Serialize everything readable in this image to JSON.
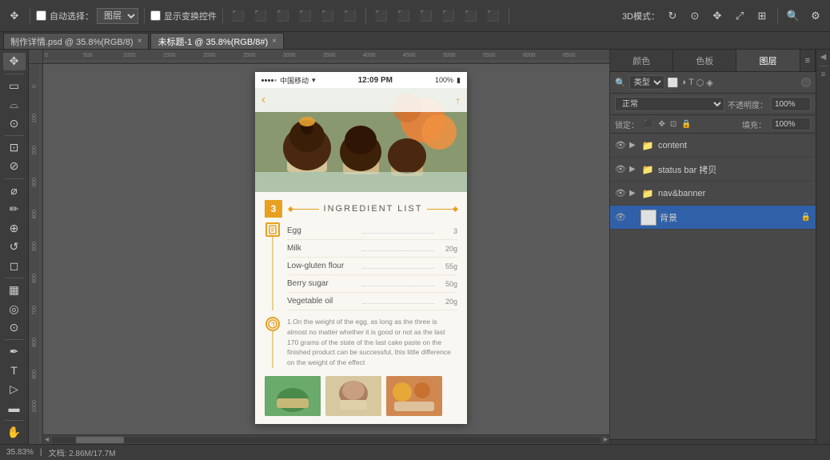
{
  "app": {
    "title": "Adobe Photoshop"
  },
  "toolbar": {
    "auto_select_label": "自动选择：",
    "layer_label": "图层",
    "transform_label": "显示变换控件",
    "mode_label": "3D模式："
  },
  "tabs": [
    {
      "id": "tab1",
      "label": "制作详情.psd @ 35.8%(RGB/8)",
      "active": false,
      "modified": true
    },
    {
      "id": "tab2",
      "label": "未标题-1 @ 35.8%(RGB/8#)",
      "active": true,
      "modified": true
    }
  ],
  "phone": {
    "status_bar": {
      "signal": "●●●●○",
      "carrier": "中国移动",
      "wifi": "▼",
      "time": "12:09 PM",
      "battery": "100%"
    },
    "nav": {
      "back": "‹",
      "title": "",
      "share": "↑"
    },
    "step_number": "3",
    "section_title": "INGREDIENT LIST",
    "ingredients": [
      {
        "name": "Egg",
        "amount": "3"
      },
      {
        "name": "Milk",
        "amount": "20g"
      },
      {
        "name": "Low-gluten flour",
        "amount": "55g"
      },
      {
        "name": "Berry sugar",
        "amount": "50g"
      },
      {
        "name": "Vegetable oil",
        "amount": "20g"
      }
    ],
    "instruction_text": "1.On the weight of the egg, as long as the three is almost no matter whether it is good or not as the last 170 grams of the state of the last cake paste on the finished product can be successful, this little difference on the weight of the effect"
  },
  "right_panel": {
    "tabs": [
      {
        "label": "颜色",
        "active": false
      },
      {
        "label": "色板",
        "active": false
      },
      {
        "label": "图层",
        "active": true
      }
    ],
    "search": {
      "placeholder": "",
      "filter": "类型"
    },
    "blend_mode": "正常",
    "opacity_label": "不透明度：",
    "opacity_value": "100%",
    "lock_label": "锁定：",
    "fill_label": "填充：",
    "fill_value": "100%",
    "layers": [
      {
        "id": "l1",
        "name": "content",
        "type": "folder",
        "visible": true,
        "locked": false
      },
      {
        "id": "l2",
        "name": "status bar 拷贝",
        "type": "folder",
        "visible": true,
        "locked": false
      },
      {
        "id": "l3",
        "name": "nav&banner",
        "type": "folder",
        "visible": true,
        "locked": false
      },
      {
        "id": "l4",
        "name": "背景",
        "type": "image",
        "visible": true,
        "locked": true
      }
    ]
  },
  "status_bar": {
    "zoom": "35.83%",
    "doc_size": "文档: 2.86M/17.7M"
  }
}
